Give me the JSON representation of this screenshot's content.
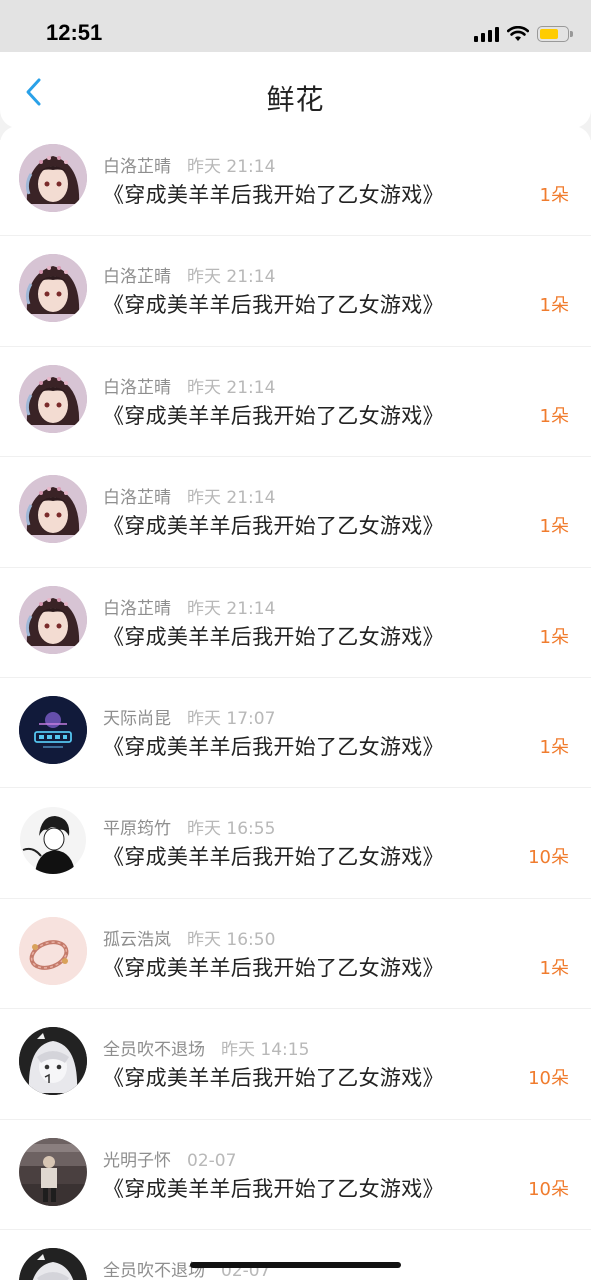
{
  "status_bar": {
    "time": "12:51"
  },
  "header": {
    "title": "鲜花"
  },
  "colors": {
    "accent": "#2aa1e8",
    "count": "#f07c2e",
    "battery": "#ffcc00"
  },
  "items": [
    {
      "user": "白洛芷晴",
      "time": "昨天 21:14",
      "book": "《穿成美羊羊后我开始了乙女游戏》",
      "count": "1朵",
      "avatar": "anime-girl"
    },
    {
      "user": "白洛芷晴",
      "time": "昨天 21:14",
      "book": "《穿成美羊羊后我开始了乙女游戏》",
      "count": "1朵",
      "avatar": "anime-girl"
    },
    {
      "user": "白洛芷晴",
      "time": "昨天 21:14",
      "book": "《穿成美羊羊后我开始了乙女游戏》",
      "count": "1朵",
      "avatar": "anime-girl"
    },
    {
      "user": "白洛芷晴",
      "time": "昨天 21:14",
      "book": "《穿成美羊羊后我开始了乙女游戏》",
      "count": "1朵",
      "avatar": "anime-girl"
    },
    {
      "user": "白洛芷晴",
      "time": "昨天 21:14",
      "book": "《穿成美羊羊后我开始了乙女游戏》",
      "count": "1朵",
      "avatar": "anime-girl"
    },
    {
      "user": "天际尚昆",
      "time": "昨天 17:07",
      "book": "《穿成美羊羊后我开始了乙女游戏》",
      "count": "1朵",
      "avatar": "dark-logo"
    },
    {
      "user": "平原筠竹",
      "time": "昨天 16:55",
      "book": "《穿成美羊羊后我开始了乙女游戏》",
      "count": "10朵",
      "avatar": "sketch-boy"
    },
    {
      "user": "孤云浩岚",
      "time": "昨天 16:50",
      "book": "《穿成美羊羊后我开始了乙女游戏》",
      "count": "1朵",
      "avatar": "pink-bracelet"
    },
    {
      "user": "全员吹不退场",
      "time": "昨天 14:15",
      "book": "《穿成美羊羊后我开始了乙女游戏》",
      "count": "10朵",
      "avatar": "white-hair"
    },
    {
      "user": "光明子怀",
      "time": "02-07",
      "book": "《穿成美羊羊后我开始了乙女游戏》",
      "count": "10朵",
      "avatar": "street-photo"
    },
    {
      "user": "全员吹不退场",
      "time": "02-07",
      "book": "",
      "count": "",
      "avatar": "white-hair"
    }
  ]
}
